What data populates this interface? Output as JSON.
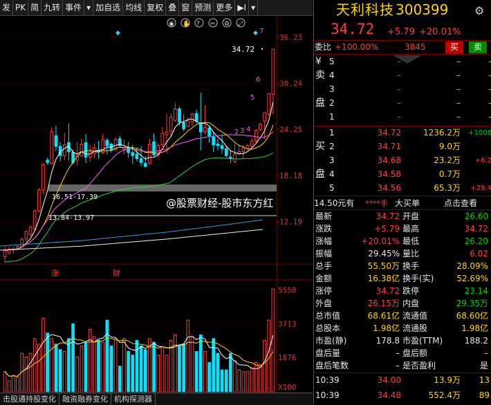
{
  "toolbar": {
    "items": [
      "发",
      "PK",
      "简",
      "九转",
      "事件",
      "▾",
      "加自选",
      "均线",
      "复权",
      "叠",
      "窗",
      "预测",
      "更多",
      "▶I",
      "▾"
    ]
  },
  "chart": {
    "ylabels": [
      "36.23",
      "30.24",
      "24.25",
      "18.18",
      "12.19"
    ],
    "vol_labels": [
      "5550",
      "3713",
      "1876",
      "X100"
    ],
    "price_tag": "34.72",
    "annot1": "16.51-17.39",
    "annot2": "13.84-13.97",
    "wave_labels": [
      "2",
      "3",
      "4",
      "5",
      "6",
      "7"
    ],
    "markers": [
      "涨",
      "财"
    ],
    "icons": [
      "eye-icon",
      "hand-icon",
      "question-icon",
      "scissors-icon",
      "gear-icon",
      "expand-icon"
    ]
  },
  "bottom_tabs": [
    "击股通持股变化",
    "融资融券变化",
    "机构探测器"
  ],
  "watermark": "@股票财经-股市东方红",
  "stock": {
    "name": "天利科技",
    "code": "300399",
    "price": "34.72",
    "change": "+5.79",
    "pct": "+20.01%",
    "weibi_label": "委比",
    "weibi": "+100.00%",
    "weicha": "3845",
    "buy_btn": "买",
    "sell_btn": "卖"
  },
  "sell_levels": [
    {
      "label": "¥",
      "lvl": "5",
      "price": "",
      "vol": "–",
      "chg": "–"
    },
    {
      "label": "卖",
      "lvl": "4",
      "price": "",
      "vol": "–",
      "chg": "–"
    },
    {
      "label": "",
      "lvl": "3",
      "price": "",
      "vol": "–",
      "chg": "–"
    },
    {
      "label": "盘",
      "lvl": "2",
      "price": "",
      "vol": "–",
      "chg": "–"
    },
    {
      "label": "",
      "lvl": "1",
      "price": "",
      "vol": "–",
      "chg": "–"
    }
  ],
  "buy_levels": [
    {
      "label": "",
      "lvl": "1",
      "price": "34.72",
      "vol": "1236.2万",
      "chg": "+1008"
    },
    {
      "label": "买",
      "lvl": "2",
      "price": "34.71",
      "vol": "9.0万",
      "chg": ""
    },
    {
      "label": "",
      "lvl": "3",
      "price": "34.68",
      "vol": "23.2万",
      "chg": "+6.2"
    },
    {
      "label": "盘",
      "lvl": "4",
      "price": "34.58",
      "vol": "0.7万",
      "chg": ""
    },
    {
      "label": "",
      "lvl": "5",
      "price": "34.56",
      "vol": "65.3万",
      "chg": "+29.4"
    }
  ],
  "big_order": {
    "text": "大买单",
    "sub": "14.50元有",
    "mask": "****手",
    "link": "点击查看"
  },
  "stats": [
    {
      "k1": "最新",
      "v1": "34.72",
      "c1": "red",
      "k2": "开盘",
      "v2": "26.60",
      "c2": "green"
    },
    {
      "k1": "涨跌",
      "v1": "+5.79",
      "c1": "red",
      "k2": "最高",
      "v2": "34.72",
      "c2": "red"
    },
    {
      "k1": "涨幅",
      "v1": "+20.01%",
      "c1": "red",
      "k2": "最低",
      "v2": "26.20",
      "c2": "green"
    },
    {
      "k1": "振幅",
      "v1": "29.45%",
      "c1": "white",
      "k2": "量比",
      "v2": "6.02",
      "c2": "red"
    },
    {
      "k1": "总手",
      "v1": "55.50万",
      "c1": "yel",
      "k2": "换手",
      "v2": "28.09%",
      "c2": "yel"
    },
    {
      "k1": "金额",
      "v1": "16.38亿",
      "c1": "yel",
      "k2": "换手(实)",
      "v2": "52.69%",
      "c2": "yel"
    },
    {
      "k1": "涨停",
      "v1": "34.72",
      "c1": "red",
      "k2": "跌停",
      "v2": "23.14",
      "c2": "green"
    },
    {
      "k1": "外盘",
      "v1": "26.15万",
      "c1": "red",
      "k2": "内盘",
      "v2": "29.35万",
      "c2": "green"
    },
    {
      "k1": "总市值",
      "v1": "68.61亿",
      "c1": "yel",
      "k2": "流通值",
      "v2": "68.60亿",
      "c2": "yel"
    },
    {
      "k1": "总股本",
      "v1": "1.98亿",
      "c1": "yel",
      "k2": "流通股",
      "v2": "1.98亿",
      "c2": "yel"
    },
    {
      "k1": "市盈(静)",
      "v1": "178.8",
      "c1": "white",
      "k2": "市盈(TTM)",
      "v2": "188.2",
      "c2": "white"
    },
    {
      "k1": "盘后量",
      "v1": "–",
      "c1": "white",
      "k2": "盘后额",
      "v2": "–",
      "c2": "white"
    },
    {
      "k1": "盘后笔数",
      "v1": "–",
      "c1": "white",
      "k2": "是否盈利",
      "v2": "是",
      "c2": "white"
    }
  ],
  "ticks": [
    {
      "time": "10:39",
      "price": "34.00",
      "vol": "13.9万",
      "n": "13"
    },
    {
      "time": "10:39",
      "price": "34.48",
      "vol": "552.4万",
      "n": "89"
    }
  ],
  "candles": [
    [
      7.6,
      8.4,
      6.8,
      8.9
    ],
    [
      8.1,
      8.6,
      7.9,
      8.9
    ],
    [
      8.5,
      8.6,
      8.0,
      8.9
    ],
    [
      8.6,
      8.9,
      8.4,
      9.2
    ],
    [
      8.9,
      9.9,
      8.7,
      10.1
    ],
    [
      9.9,
      10.9,
      9.6,
      11.0
    ],
    [
      10.5,
      11.5,
      10.2,
      11.6
    ],
    [
      11.2,
      13.6,
      11.0,
      13.8
    ],
    [
      13.6,
      16.3,
      13.4,
      16.6
    ],
    [
      16.3,
      19.6,
      15.8,
      19.8
    ],
    [
      20.2,
      19.9,
      19.6,
      20.5
    ],
    [
      19.8,
      23.9,
      19.6,
      24.5
    ],
    [
      23.4,
      22.0,
      21.4,
      24.7
    ],
    [
      22.0,
      20.8,
      20.0,
      22.6
    ],
    [
      20.8,
      22.2,
      20.2,
      23.8
    ],
    [
      22.5,
      21.3,
      20.2,
      25.0
    ],
    [
      21.2,
      19.9,
      19.6,
      21.6
    ],
    [
      20.2,
      20.9,
      19.4,
      22.6
    ],
    [
      20.8,
      22.3,
      20.6,
      23.0
    ],
    [
      22.5,
      20.6,
      19.8,
      23.6
    ],
    [
      20.6,
      21.3,
      20.0,
      22.2
    ],
    [
      21.1,
      21.8,
      20.5,
      22.4
    ],
    [
      21.5,
      21.3,
      20.4,
      22.7
    ],
    [
      21.2,
      22.9,
      21.0,
      23.6
    ],
    [
      22.8,
      22.1,
      21.0,
      23.1
    ],
    [
      22.3,
      21.5,
      21.2,
      22.5
    ],
    [
      21.6,
      22.9,
      21.4,
      23.2
    ],
    [
      23.0,
      22.1,
      21.8,
      23.4
    ],
    [
      21.6,
      21.8,
      21.0,
      22.9
    ],
    [
      21.8,
      21.2,
      20.5,
      22.6
    ],
    [
      21.2,
      20.8,
      19.7,
      22.2
    ],
    [
      21.0,
      20.4,
      20.1,
      21.9
    ],
    [
      20.4,
      19.9,
      19.4,
      22.0
    ],
    [
      19.8,
      19.4,
      19.3,
      20.7
    ],
    [
      19.8,
      22.3,
      19.6,
      23.0
    ],
    [
      22.6,
      20.9,
      20.7,
      23.7
    ],
    [
      20.9,
      22.1,
      20.5,
      22.4
    ],
    [
      22.2,
      23.7,
      21.9,
      24.5
    ],
    [
      23.5,
      23.9,
      21.1,
      26.3
    ],
    [
      24.0,
      25.8,
      23.4,
      26.3
    ],
    [
      25.4,
      26.9,
      25.2,
      27.7
    ],
    [
      26.9,
      25.2,
      24.7,
      27.2
    ],
    [
      25.1,
      24.3,
      24.0,
      26.2
    ],
    [
      24.6,
      25.3,
      24.5,
      25.8
    ],
    [
      25.2,
      26.2,
      24.6,
      26.4
    ],
    [
      26.3,
      25.3,
      25.0,
      26.8
    ],
    [
      25.0,
      23.9,
      21.5,
      29.0
    ],
    [
      23.9,
      24.5,
      23.6,
      27.4
    ],
    [
      24.4,
      23.4,
      22.5,
      24.6
    ],
    [
      23.2,
      22.2,
      21.3,
      23.8
    ],
    [
      22.3,
      22.1,
      21.5,
      23.0
    ],
    [
      22.1,
      21.7,
      21.1,
      23.6
    ],
    [
      21.7,
      20.8,
      20.5,
      22.1
    ],
    [
      20.6,
      20.4,
      19.8,
      21.4
    ],
    [
      20.0,
      21.0,
      19.8,
      22.4
    ],
    [
      21.0,
      21.3,
      20.9,
      22.2
    ],
    [
      21.3,
      21.8,
      20.4,
      22.2
    ],
    [
      21.7,
      22.1,
      21.4,
      22.3
    ],
    [
      22.0,
      22.7,
      21.8,
      23.1
    ],
    [
      22.7,
      24.1,
      22.4,
      24.2
    ],
    [
      24.2,
      24.9,
      24.0,
      25.1
    ],
    [
      25.3,
      26.4,
      23.0,
      26.4
    ],
    [
      26.2,
      28.9,
      26.0,
      28.9
    ],
    [
      28.8,
      34.7,
      26.2,
      34.7
    ]
  ],
  "volumes": [
    1.1,
    0.6,
    0.9,
    0.8,
    2.1,
    1.9,
    2.1,
    2.9,
    2.6,
    4.0,
    3.2,
    2.9,
    2.6,
    2.3,
    2.2,
    2.9,
    3.7,
    1.9,
    2.5,
    2.7,
    3.4,
    3.0,
    2.8,
    2.7,
    3.9,
    2.5,
    2.9,
    1.4,
    2.9,
    2.2,
    2.0,
    2.8,
    2.5,
    2.3,
    2.9,
    2.7,
    2.0,
    2.4,
    2.0,
    2.8,
    3.1,
    2.5,
    2.6,
    3.9,
    3.0,
    2.2,
    3.1,
    2.2,
    1.6,
    2.9,
    2.1,
    1.2,
    1.2,
    2.1,
    1.7,
    1.2,
    1.1,
    1.1,
    1.3,
    1.6,
    1.5,
    2.8,
    3.9,
    5.6
  ]
}
